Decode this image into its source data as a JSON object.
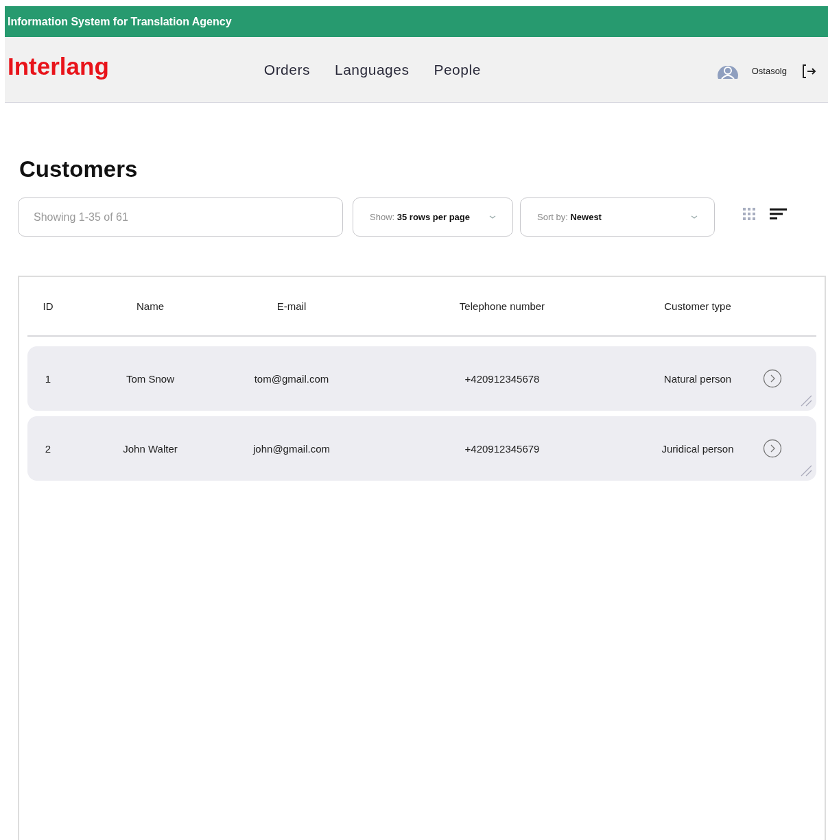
{
  "banner": {
    "title": "Information System for Translation Agency"
  },
  "header": {
    "logo": "Interlang",
    "nav": [
      {
        "label": "Orders"
      },
      {
        "label": "Languages"
      },
      {
        "label": "People"
      }
    ],
    "user": "Ostasolg"
  },
  "page_title": "Customers",
  "toolbar": {
    "search": {
      "placeholder": "Showing 1-35 of 61"
    },
    "show": {
      "label": "Show:",
      "value": "35 rows per page"
    },
    "sort": {
      "label": "Sort by:",
      "value": "Newest"
    }
  },
  "table": {
    "columns": [
      "ID",
      "Name",
      "E-mail",
      "Telephone number",
      "Customer type"
    ],
    "rows": [
      [
        "1",
        "Tom Snow",
        "tom@gmail.com",
        "+420912345678",
        "Natural person"
      ],
      [
        "2",
        "John Walter",
        "john@gmail.com",
        "+420912345679",
        "Juridical person"
      ]
    ]
  }
}
